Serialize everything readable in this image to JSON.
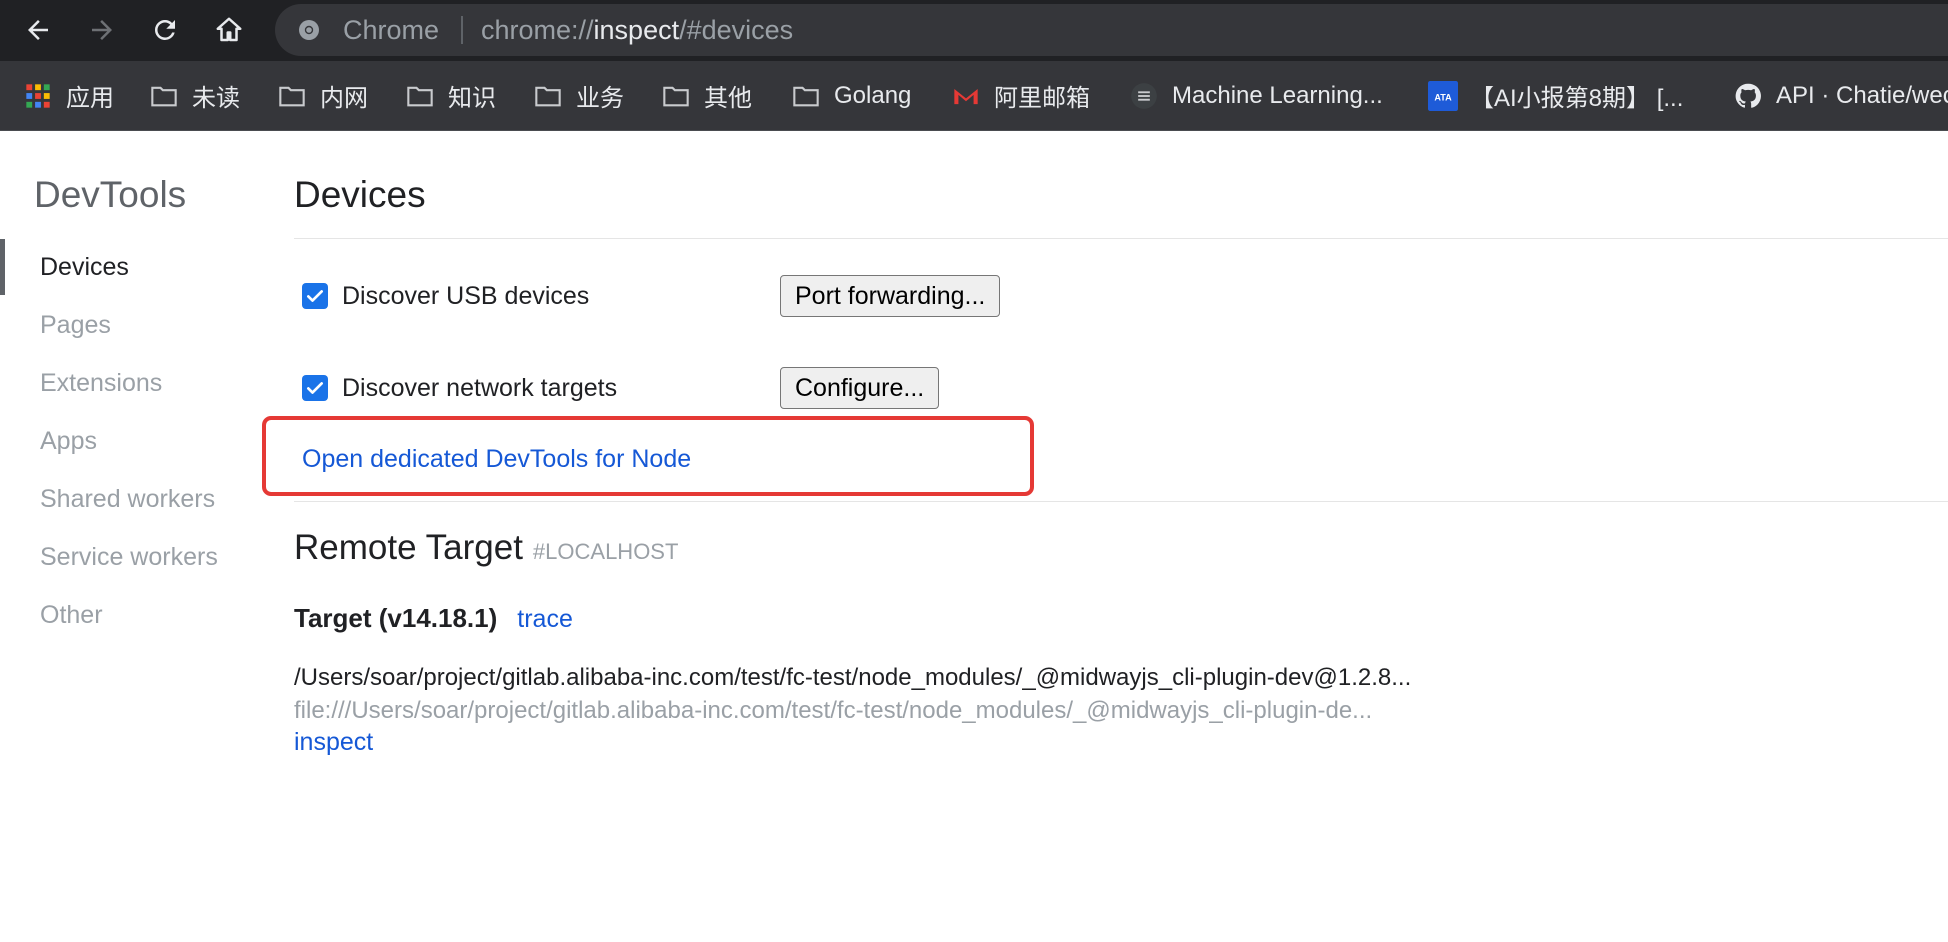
{
  "browser": {
    "omnibox": {
      "chip_label": "Chrome",
      "url_scheme": "chrome://",
      "url_host": "inspect",
      "url_path": "/#devices"
    },
    "bookmarks": [
      {
        "label": "应用",
        "icon": "apps-grid-icon"
      },
      {
        "label": "未读",
        "icon": "folder-icon"
      },
      {
        "label": "内网",
        "icon": "folder-icon"
      },
      {
        "label": "知识",
        "icon": "folder-icon"
      },
      {
        "label": "业务",
        "icon": "folder-icon"
      },
      {
        "label": "其他",
        "icon": "folder-icon"
      },
      {
        "label": "Golang",
        "icon": "folder-icon"
      },
      {
        "label": "阿里邮箱",
        "icon": "mail-logo-icon"
      },
      {
        "label": "Machine Learning...",
        "icon": "ml-site-icon"
      },
      {
        "label": "【AI小报第8期】 [...",
        "icon": "ata-logo-icon"
      },
      {
        "label": "API · Chatie/wechaty",
        "icon": "github-icon"
      }
    ],
    "ata_logo_text": "ATA"
  },
  "sidebar": {
    "title": "DevTools",
    "items": [
      {
        "label": "Devices",
        "active": true
      },
      {
        "label": "Pages",
        "active": false
      },
      {
        "label": "Extensions",
        "active": false
      },
      {
        "label": "Apps",
        "active": false
      },
      {
        "label": "Shared workers",
        "active": false
      },
      {
        "label": "Service workers",
        "active": false
      },
      {
        "label": "Other",
        "active": false
      }
    ]
  },
  "main": {
    "title": "Devices",
    "usb": {
      "label": "Discover USB devices",
      "checked": true,
      "button": "Port forwarding..."
    },
    "network": {
      "label": "Discover network targets",
      "checked": true,
      "button": "Configure..."
    },
    "node_link": "Open dedicated DevTools for Node",
    "remote": {
      "title": "Remote Target",
      "subtitle": "#LOCALHOST",
      "target_name": "Target (v14.18.1)",
      "trace_link": "trace",
      "path": "/Users/soar/project/gitlab.alibaba-inc.com/test/fc-test/node_modules/_@midwayjs_cli-plugin-dev@1.2.8...",
      "url": "file:///Users/soar/project/gitlab.alibaba-inc.com/test/fc-test/node_modules/_@midwayjs_cli-plugin-de...",
      "inspect_link": "inspect"
    }
  },
  "colors": {
    "link": "#1558d6",
    "checkbox": "#1a73e8",
    "highlight": "#e53935",
    "toolbar": "#202124",
    "bookmarks_bar": "#35363a"
  }
}
